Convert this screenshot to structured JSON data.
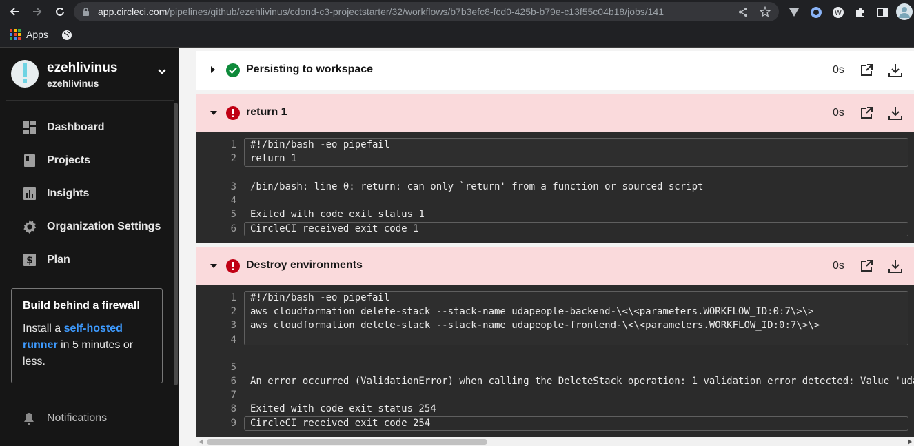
{
  "browser": {
    "url_host": "app.circleci.com",
    "url_path": "/pipelines/github/ezehlivinus/cdond-c3-projectstarter/32/workflows/b7b3efc8-fcd0-425b-b79e-c13f55c04b18/jobs/141",
    "bookmarks_apps_label": "Apps"
  },
  "sidebar": {
    "org_name": "ezehlivinus",
    "org_sub": "ezehlivinus",
    "items": [
      {
        "label": "Dashboard",
        "icon": "dashboard-icon"
      },
      {
        "label": "Projects",
        "icon": "projects-icon"
      },
      {
        "label": "Insights",
        "icon": "insights-icon"
      },
      {
        "label": "Organization Settings",
        "icon": "gear-icon"
      },
      {
        "label": "Plan",
        "icon": "dollar-icon"
      }
    ],
    "promo": {
      "title": "Build behind a firewall",
      "text_before": "Install a ",
      "link": "self-hosted runner",
      "text_after": " in 5 minutes or less."
    },
    "notifications_label": "Notifications"
  },
  "steps": [
    {
      "title": "Persisting to workspace",
      "duration": "0s",
      "status": "success"
    },
    {
      "title": "return 1",
      "duration": "0s",
      "status": "failed",
      "lines": [
        {
          "n": "1",
          "text": "#!/bin/bash -eo pipefail"
        },
        {
          "n": "2",
          "text": "return 1"
        },
        {
          "n": "3",
          "text": "/bin/bash: line 0: return: can only `return' from a function or sourced script"
        },
        {
          "n": "4",
          "text": ""
        },
        {
          "n": "5",
          "text": "Exited with code exit status 1"
        },
        {
          "n": "6",
          "text": "CircleCI received exit code 1"
        }
      ]
    },
    {
      "title": "Destroy environments",
      "duration": "0s",
      "status": "failed",
      "lines": [
        {
          "n": "1",
          "text": "#!/bin/bash -eo pipefail"
        },
        {
          "n": "2",
          "text": "aws cloudformation delete-stack --stack-name udapeople-backend-\\<\\<parameters.WORKFLOW_ID:0:7\\>\\>"
        },
        {
          "n": "3",
          "text": "aws cloudformation delete-stack --stack-name udapeople-frontend-\\<\\<parameters.WORKFLOW_ID:0:7\\>\\>"
        },
        {
          "n": "4",
          "text": ""
        },
        {
          "n": "5",
          "text": ""
        },
        {
          "n": "6",
          "text": "An error occurred (ValidationError) when calling the DeleteStack operation: 1 validation error detected: Value 'uda"
        },
        {
          "n": "7",
          "text": ""
        },
        {
          "n": "8",
          "text": "Exited with code exit status 254"
        },
        {
          "n": "9",
          "text": "CircleCI received exit code 254"
        }
      ]
    }
  ],
  "colors": {
    "success": "#0e8a3a",
    "failed": "#c00014",
    "failed_header_bg": "#fadadc",
    "link": "#3e9bff"
  }
}
